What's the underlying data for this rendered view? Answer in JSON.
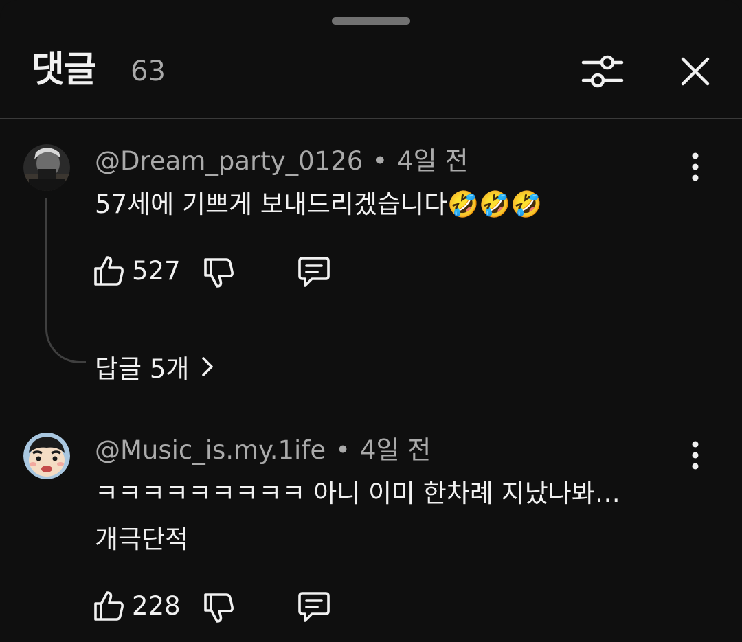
{
  "header": {
    "title": "댓글",
    "count": "63",
    "filter_icon": "sliders-icon",
    "close_icon": "close-icon"
  },
  "comments": [
    {
      "author": "@Dream_party_0126",
      "separator": "•",
      "time": "4일 전",
      "lines": [
        "57세에 기쁘게 보내드리겠습니다🤣🤣🤣"
      ],
      "likes": "527",
      "replies": "답글 5개"
    },
    {
      "author": "@Music_is.my.1ife",
      "separator": "•",
      "time": "4일 전",
      "lines": [
        "ㅋㅋㅋㅋㅋㅋㅋㅋㅋ 아니 이미 한차례 지났나봐…",
        "개극단적"
      ],
      "likes": "228"
    }
  ],
  "colors": {
    "background": "#0f0f0f",
    "text_primary": "#f1f1f1",
    "text_secondary": "#aaaaaa",
    "divider": "#3a3a3a"
  }
}
